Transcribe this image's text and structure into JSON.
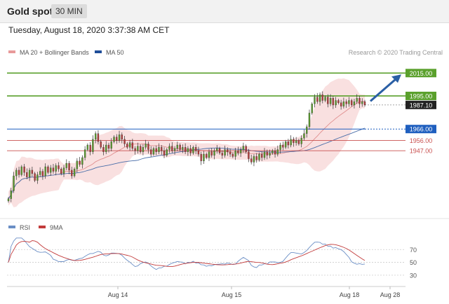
{
  "header": {
    "title": "Gold spot",
    "interval": "30 MIN",
    "datetime": "Tuesday, August 18, 2020 3:37:38 AM CET"
  },
  "colors": {
    "resistance": "#5aa02c",
    "pivot": "#1f5fbf",
    "support": "#c9504f",
    "current": "#222222",
    "candle_up": "#5a9a2e",
    "candle_down": "#b23b3b",
    "ma50": "#4a6ea9",
    "bands": "#f4c6c6",
    "rsi": "#6a8ec5",
    "rsi_ma": "#c23b3b"
  },
  "chart_data": [
    {
      "type": "candlestick",
      "legend": [
        {
          "name": "MA 20 + Bollinger Bands",
          "color": "#e89a9a"
        },
        {
          "name": "MA 50",
          "color": "#1f4e99"
        }
      ],
      "credit": "Research © 2020 Trading Central",
      "ylim": [
        1895,
        2025
      ],
      "levels": [
        {
          "label": "2015.00",
          "value": 2015.0,
          "kind": "resistance"
        },
        {
          "label": "1995.00",
          "value": 1995.0,
          "kind": "resistance"
        },
        {
          "label": "1987.10",
          "value": 1987.1,
          "kind": "current"
        },
        {
          "label": "1966.00",
          "value": 1966.0,
          "kind": "pivot"
        },
        {
          "label": "1956.00",
          "value": 1956.0,
          "kind": "support"
        },
        {
          "label": "1947.00",
          "value": 1947.0,
          "kind": "support"
        }
      ],
      "target_arrow": {
        "from": 1988,
        "to": 2015
      },
      "x_ticks": [
        "Aug 14",
        "Aug 15",
        "Aug 18",
        "Aug 28"
      ],
      "closes": [
        1905,
        1912,
        1925,
        1930,
        1926,
        1933,
        1928,
        1924,
        1930,
        1927,
        1921,
        1926,
        1929,
        1925,
        1933,
        1928,
        1932,
        1929,
        1934,
        1931,
        1927,
        1932,
        1936,
        1930,
        1925,
        1931,
        1938,
        1935,
        1941,
        1948,
        1952,
        1946,
        1957,
        1962,
        1955,
        1950,
        1946,
        1952,
        1949,
        1955,
        1959,
        1956,
        1961,
        1957,
        1953,
        1950,
        1954,
        1949,
        1947,
        1951,
        1946,
        1950,
        1953,
        1948,
        1944,
        1949,
        1946,
        1950,
        1947,
        1943,
        1948,
        1951,
        1947,
        1949,
        1952,
        1948,
        1950,
        1946,
        1949,
        1945,
        1950,
        1947,
        1944,
        1938,
        1944,
        1941,
        1946,
        1943,
        1947,
        1949,
        1945,
        1943,
        1948,
        1946,
        1944,
        1942,
        1947,
        1945,
        1948,
        1951,
        1946,
        1940,
        1937,
        1942,
        1939,
        1944,
        1941,
        1946,
        1943,
        1945,
        1947,
        1944,
        1948,
        1952,
        1950,
        1955,
        1952,
        1957,
        1954,
        1956,
        1953,
        1958,
        1962,
        1968,
        1980,
        1988,
        1994,
        1990,
        1996,
        1991,
        1994,
        1988,
        1993,
        1987,
        1991,
        1989,
        1986,
        1990,
        1988,
        1991,
        1987,
        1990,
        1993,
        1988,
        1990,
        1987.1
      ],
      "rsi_legend": [
        {
          "name": "RSI",
          "color": "#6a8ec5"
        },
        {
          "name": "9MA",
          "color": "#c23b3b"
        }
      ],
      "rsi_ticks": [
        "70",
        "50",
        "30"
      ]
    }
  ]
}
